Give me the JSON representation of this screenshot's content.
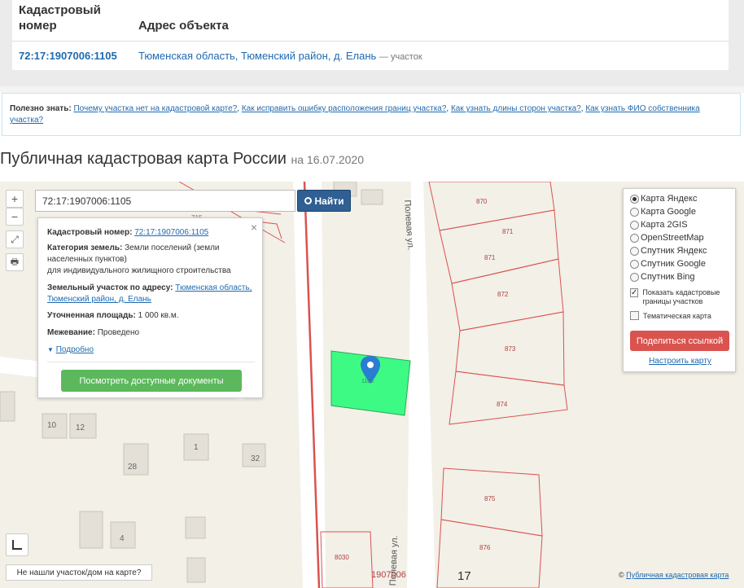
{
  "results_table": {
    "col_cadastral": "Кадастровый номер",
    "col_address": "Адрес объекта",
    "row": {
      "cadastral_number": "72:17:1907006:1105",
      "address": "Тюменская область, Тюменский район, д. Елань",
      "suffix": "— участок"
    }
  },
  "tips": {
    "label": "Полезно знать:",
    "links": [
      "Почему участка нет на кадастровой карте?",
      "Как исправить ошибку расположения границ участка?",
      "Как узнать длины сторон участка?",
      "Как узнать ФИО собственника участка?"
    ]
  },
  "page": {
    "title": "Публичная кадастровая карта России",
    "date": "на 16.07.2020"
  },
  "map": {
    "search_value": "72:17:1907006:1105",
    "find_label": "Найти",
    "zoom_in": "+",
    "zoom_out": "−",
    "popup": {
      "cad_label": "Кадастровый номер:",
      "cad_value": "72:17:1907006:1105",
      "category_label": "Категория земель:",
      "category_value": "Земли поселений (земли населенных пунктов)",
      "category_use": "для индивидуального жилищного строительства",
      "address_label": "Земельный участок по адресу:",
      "address_value": "Тюменская область, Тюменский район, д. Елань",
      "area_label": "Уточненная площадь:",
      "area_value": "1 000 кв.м.",
      "survey_label": "Межевание:",
      "survey_value": "Проведено",
      "more_label": "Подробно",
      "docs_button": "Посмотреть доступные документы"
    },
    "layers": {
      "options": [
        "Карта Яндекс",
        "Карта Google",
        "Карта 2GIS",
        "OpenStreetMap",
        "Спутник Яндекс",
        "Спутник Google",
        "Спутник Bing"
      ],
      "selected": "Карта Яндекс",
      "show_boundaries": "Показать кадастровые границы участков",
      "thematic": "Тематическая карта",
      "share_button": "Поделиться ссылкой",
      "configure_link": "Настроить карту"
    },
    "not_found": "Не нашли участок/дом на карте?",
    "copyright_symbol": "©",
    "copyright_link": "Публичная кадастровая карта",
    "labels": {
      "street1": "Полевая ул.",
      "street2": "Полевая ул.",
      "lots": [
        "870",
        "871",
        "871",
        "872",
        "873",
        "874",
        "875",
        "876",
        "8030",
        "1907006",
        "17"
      ],
      "houses": [
        "10",
        "12",
        "1",
        "32",
        "28",
        "4"
      ],
      "lot_715": "715",
      "parcel": "1105"
    },
    "colors": {
      "parcel": "#3dfa85",
      "boundary": "#d9534f",
      "road": "#ffffff"
    }
  }
}
